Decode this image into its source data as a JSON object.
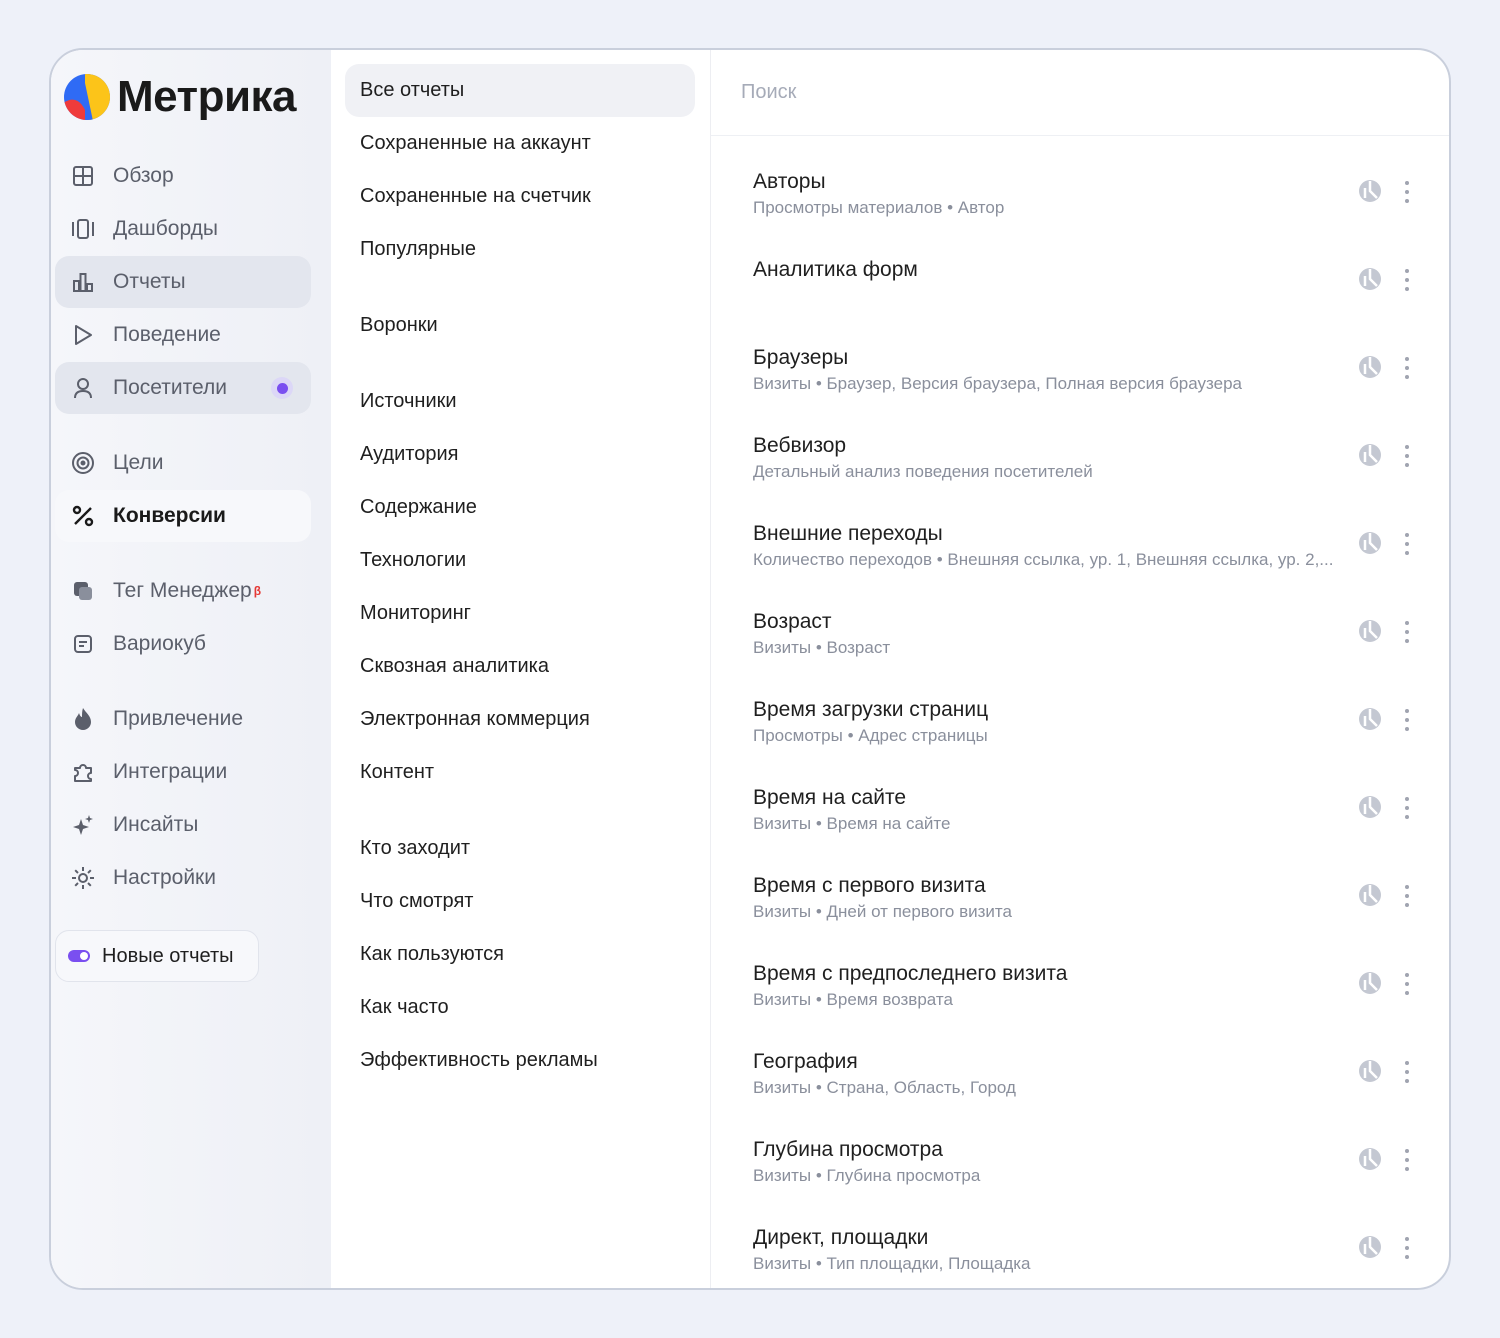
{
  "app": {
    "name": "Метрика"
  },
  "sidebar": {
    "items": [
      {
        "label": "Обзор",
        "icon": "grid-icon"
      },
      {
        "label": "Дашборды",
        "icon": "dashboard-icon"
      },
      {
        "label": "Отчеты",
        "icon": "chart-icon",
        "active": true
      },
      {
        "label": "Поведение",
        "icon": "play-icon"
      },
      {
        "label": "Посетители",
        "icon": "user-icon",
        "badge": true
      },
      {
        "label": "Цели",
        "icon": "target-icon"
      },
      {
        "label": "Конверсии",
        "icon": "percent-icon",
        "selected": true
      },
      {
        "label": "Тег Менеджер",
        "beta": "β",
        "icon": "tag-manager-icon"
      },
      {
        "label": "Вариокуб",
        "icon": "variocube-icon"
      },
      {
        "label": "Привлечение",
        "icon": "fire-icon"
      },
      {
        "label": "Интеграции",
        "icon": "puzzle-icon"
      },
      {
        "label": "Инсайты",
        "icon": "sparkle-icon"
      },
      {
        "label": "Настройки",
        "icon": "gear-icon"
      }
    ],
    "new_reports_label": "Новые отчеты"
  },
  "categories": {
    "group1": [
      "Все отчеты",
      "Сохраненные на аккаунт",
      "Сохраненные на счетчик",
      "Популярные"
    ],
    "group2": [
      "Воронки"
    ],
    "group3": [
      "Источники",
      "Аудитория",
      "Содержание",
      "Технологии",
      "Мониторинг",
      "Сквозная аналитика",
      "Электронная коммерция",
      "Контент"
    ],
    "group4": [
      "Кто заходит",
      "Что смотрят",
      "Как пользуются",
      "Как часто",
      "Эффективность рекламы"
    ]
  },
  "search": {
    "placeholder": "Поиск"
  },
  "reports": [
    {
      "title": "Авторы",
      "sub": "Просмотры материалов • Автор"
    },
    {
      "title": "Аналитика форм",
      "sub": ""
    },
    {
      "title": "Браузеры",
      "sub": "Визиты • Браузер, Версия браузера, Полная версия браузера"
    },
    {
      "title": "Вебвизор",
      "sub": "Детальный анализ поведения посетителей"
    },
    {
      "title": "Внешние переходы",
      "sub": "Количество переходов • Внешняя ссылка, ур. 1, Внешняя ссылка, ур. 2,..."
    },
    {
      "title": "Возраст",
      "sub": "Визиты • Возраст"
    },
    {
      "title": "Время загрузки страниц",
      "sub": "Просмотры • Адрес страницы"
    },
    {
      "title": "Время на сайте",
      "sub": "Визиты • Время на сайте"
    },
    {
      "title": "Время с первого визита",
      "sub": "Визиты • Дней от первого визита"
    },
    {
      "title": "Время с предпоследнего визита",
      "sub": "Визиты • Время возврата"
    },
    {
      "title": "География",
      "sub": "Визиты • Страна, Область, Город"
    },
    {
      "title": "Глубина просмотра",
      "sub": "Визиты • Глубина просмотра"
    },
    {
      "title": "Директ, площадки",
      "sub": "Визиты • Тип площадки, Площадка"
    }
  ],
  "colors": {
    "accent": "#7a4ff0",
    "beta": "#e53935"
  }
}
